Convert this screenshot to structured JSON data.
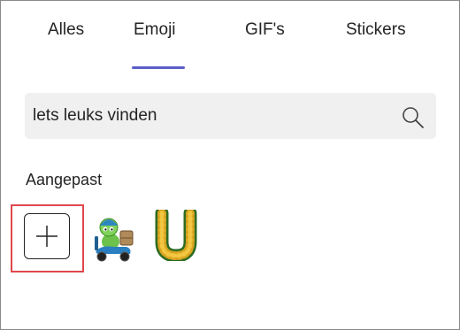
{
  "tabs": [
    {
      "label": "Alles",
      "active": false
    },
    {
      "label": "Emoji",
      "active": true
    },
    {
      "label": "GIF's",
      "active": false
    },
    {
      "label": "Stickers",
      "active": false
    }
  ],
  "search": {
    "value": "lets leuks vinden",
    "icon": "search-icon"
  },
  "section": {
    "label": "Aangepast"
  },
  "custom_items": [
    {
      "name": "add-custom-emoji",
      "icon": "plus-icon"
    },
    {
      "name": "scooter-delivery-emoji",
      "icon": "green-character-on-scooter"
    },
    {
      "name": "flower-letter-u-emoji",
      "icon": "letter-u-of-flowers"
    }
  ],
  "colors": {
    "accent": "#5b5fc7",
    "highlight": "#e0474c",
    "search_bg": "#f0f0f0"
  }
}
